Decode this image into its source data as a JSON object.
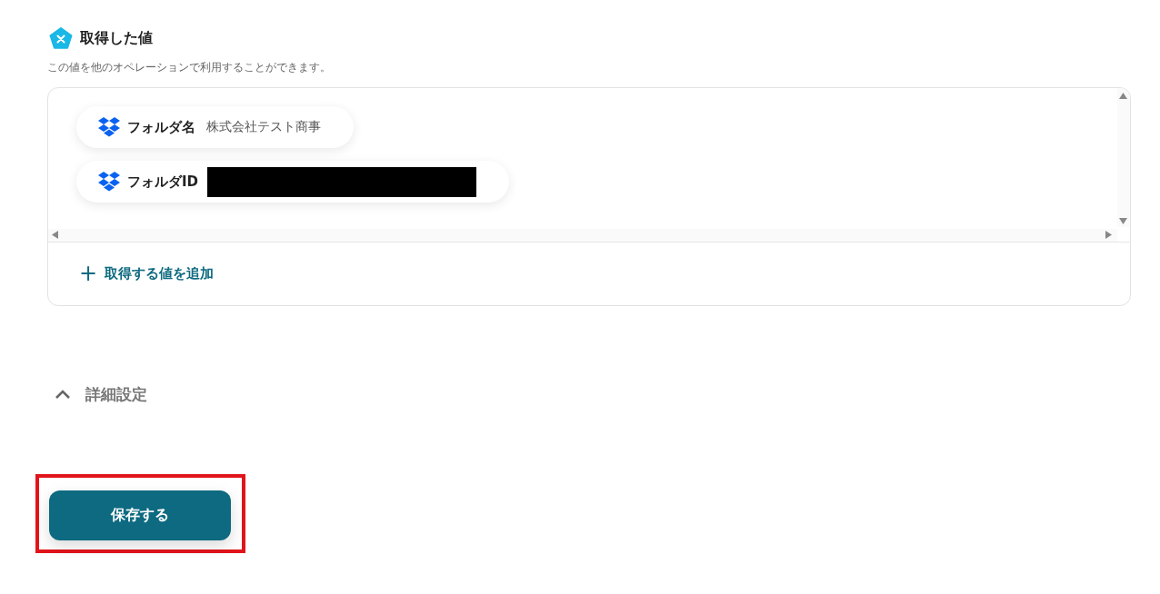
{
  "section": {
    "title": "取得した値",
    "description": "この値を他のオペレーションで利用することができます。"
  },
  "values": [
    {
      "label": "フォルダ名",
      "value": "株式会社テスト商事",
      "redacted": false
    },
    {
      "label": "フォルダID",
      "redacted": true
    }
  ],
  "add_button": {
    "icon": "+",
    "label": "取得する値を追加"
  },
  "details": {
    "label": "詳細設定",
    "expanded": true
  },
  "save_button": {
    "label": "保存する",
    "highlighted": true
  }
}
